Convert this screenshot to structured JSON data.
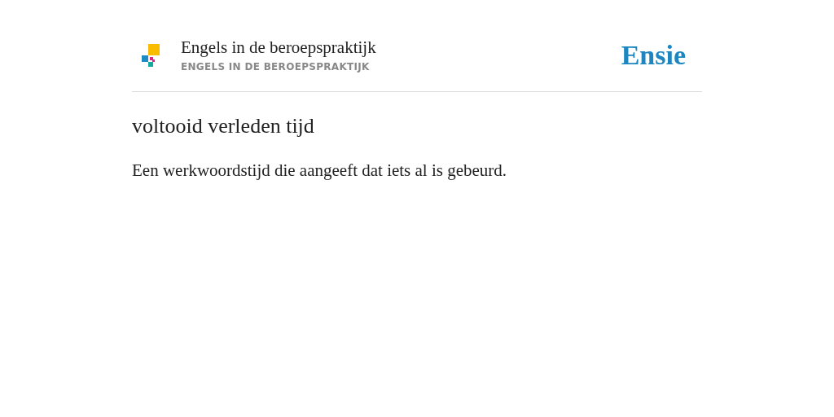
{
  "header": {
    "title": "Engels in de beroepspraktijk",
    "subtitle": "ENGELS IN DE BEROEPSPRAKTIJK",
    "brand": "Ensie"
  },
  "term": "voltooid verleden tijd",
  "definition": "Een werkwoordstijd die aangeeft dat iets al is gebeurd."
}
